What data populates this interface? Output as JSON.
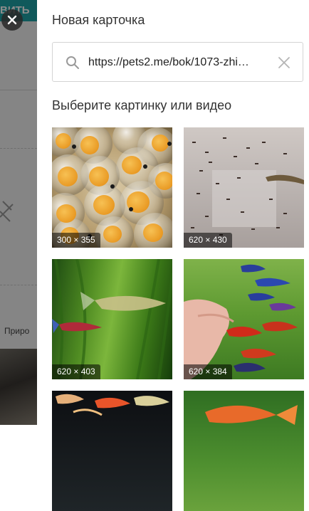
{
  "background": {
    "button_label": "ВИТЬ",
    "partial_text": "Приро"
  },
  "dialog": {
    "close_label": "×",
    "title": "Новая карточка",
    "search": {
      "value": "https://pets2.me/bok/1073-zhi…",
      "placeholder": ""
    },
    "section_heading": "Выберите картинку или видео",
    "images": [
      {
        "size": "300 × 355",
        "subject": "fish eggs with yolk"
      },
      {
        "size": "620 × 430",
        "subject": "guppy fry in container"
      },
      {
        "size": "620 × 403",
        "subject": "guppy among plants"
      },
      {
        "size": "620 × 384",
        "subject": "guppies near hand"
      },
      {
        "size": "",
        "subject": "guppies on dark background"
      },
      {
        "size": "",
        "subject": "orange fish in plants"
      }
    ]
  },
  "colors": {
    "accent_teal": "#1ea3a6",
    "overlay": "rgba(0,0,0,0.45)",
    "panel_bg": "#ffffff"
  }
}
